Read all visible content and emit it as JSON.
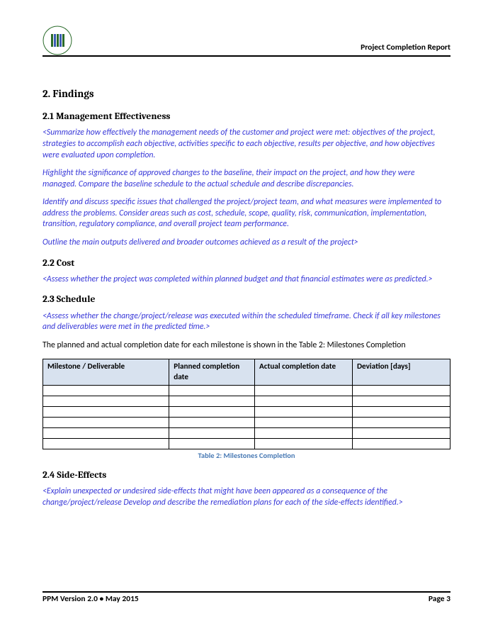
{
  "header": {
    "title": "Project Completion Report"
  },
  "sections": {
    "main_heading": "2.  Findings",
    "s21": {
      "heading": "2.1 Management Effectiveness",
      "p1": "<Summarize how effectively the management needs of the customer and project were met: objectives of the project, strategies to accomplish each objective, activities specific to each objective, results per objective, and how objectives were evaluated upon completion.",
      "p2": "Highlight the significance of approved changes to the baseline, their impact on the project, and how they were managed. Compare the baseline schedule to the actual schedule and describe discrepancies.",
      "p3": " Identify and discuss specific issues that challenged the project/project team, and what measures were implemented to address the problems. Consider areas such as cost, schedule, scope, quality, risk, communication, implementation, transition, regulatory compliance, and overall project team performance.",
      "p4": "Outline the main outputs delivered and broader outcomes achieved as a result of the project>"
    },
    "s22": {
      "heading": "2.2 Cost",
      "p1": "<Assess whether the project was completed within planned budget and that financial estimates were as predicted.>"
    },
    "s23": {
      "heading": "2.3 Schedule",
      "p1": "<Assess whether the change/project/release was executed within the scheduled timeframe. Check if all key milestones and deliverables were met in the predicted time.>",
      "body": "The planned and actual completion date for each milestone is shown in the Table 2: Milestones Completion",
      "table": {
        "headers": {
          "c1": "Milestone / Deliverable",
          "c2": "Planned completion date",
          "c3": "Actual completion date",
          "c4": "Deviation [days]"
        },
        "row_count": 6,
        "caption": "Table 2: Milestones Completion"
      }
    },
    "s24": {
      "heading": "2.4 Side-Effects",
      "p1": "<Explain unexpected or undesired side-effects that might have been appeared as a consequence of the change/project/release Develop and describe the remediation plans for each of the side-effects identified.>"
    }
  },
  "footer": {
    "left": "PPM Version 2.0 • May 2015",
    "right": "Page 3"
  }
}
